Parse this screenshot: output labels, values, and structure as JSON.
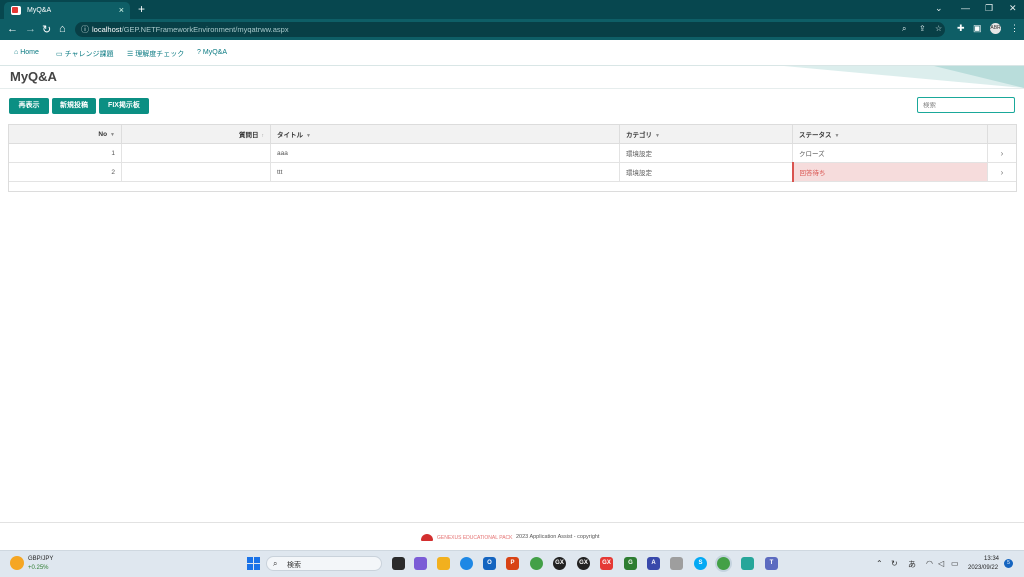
{
  "browser": {
    "tab_title": "MyQ&A",
    "new_tab": "+",
    "url_host": "localhost",
    "url_path": "/GEP.NETFrameworkEnvironment/myqatrww.aspx",
    "avatar_text": "ABR"
  },
  "nav": {
    "items": [
      {
        "label": "Home",
        "icon": "home-icon"
      },
      {
        "label": "チャレンジ課題",
        "icon": "card-icon"
      },
      {
        "label": "理解度チェック",
        "icon": "list-icon"
      },
      {
        "label": "MyQ&A",
        "icon": "question-icon"
      }
    ]
  },
  "page": {
    "title": "MyQ&A"
  },
  "toolbar": {
    "refresh_label": "再表示",
    "new_post_label": "新規投稿",
    "fix_board_label": "FIX掲示板",
    "search_placeholder": "検索"
  },
  "table": {
    "columns": [
      "No",
      "質問日",
      "タイトル",
      "カテゴリ",
      "ステータス"
    ],
    "rows": [
      {
        "no": "1",
        "date": "",
        "title": "aaa",
        "category": "環境設定",
        "status": "クローズ"
      },
      {
        "no": "2",
        "date": "",
        "title": "ttt",
        "category": "環境設定",
        "status": "回答待ち"
      }
    ]
  },
  "footer": {
    "brand": "GENEXUS EDUCATIONAL PACK",
    "copyright": "2023 Application Assist - copyright"
  },
  "taskbar": {
    "weather_label": "GBP/JPY",
    "weather_change": "+0.25%",
    "search_label": "検索",
    "time": "13:34",
    "date": "2023/09/22",
    "ime": "あ",
    "notification_count": "5"
  },
  "colors": {
    "chrome_dark": "#07474f",
    "chrome": "#0e5e66",
    "accent": "#0b8f83",
    "nav_text": "#0a7a82",
    "pending_bg": "#f6dcdc",
    "pending_text": "#d9534f"
  }
}
